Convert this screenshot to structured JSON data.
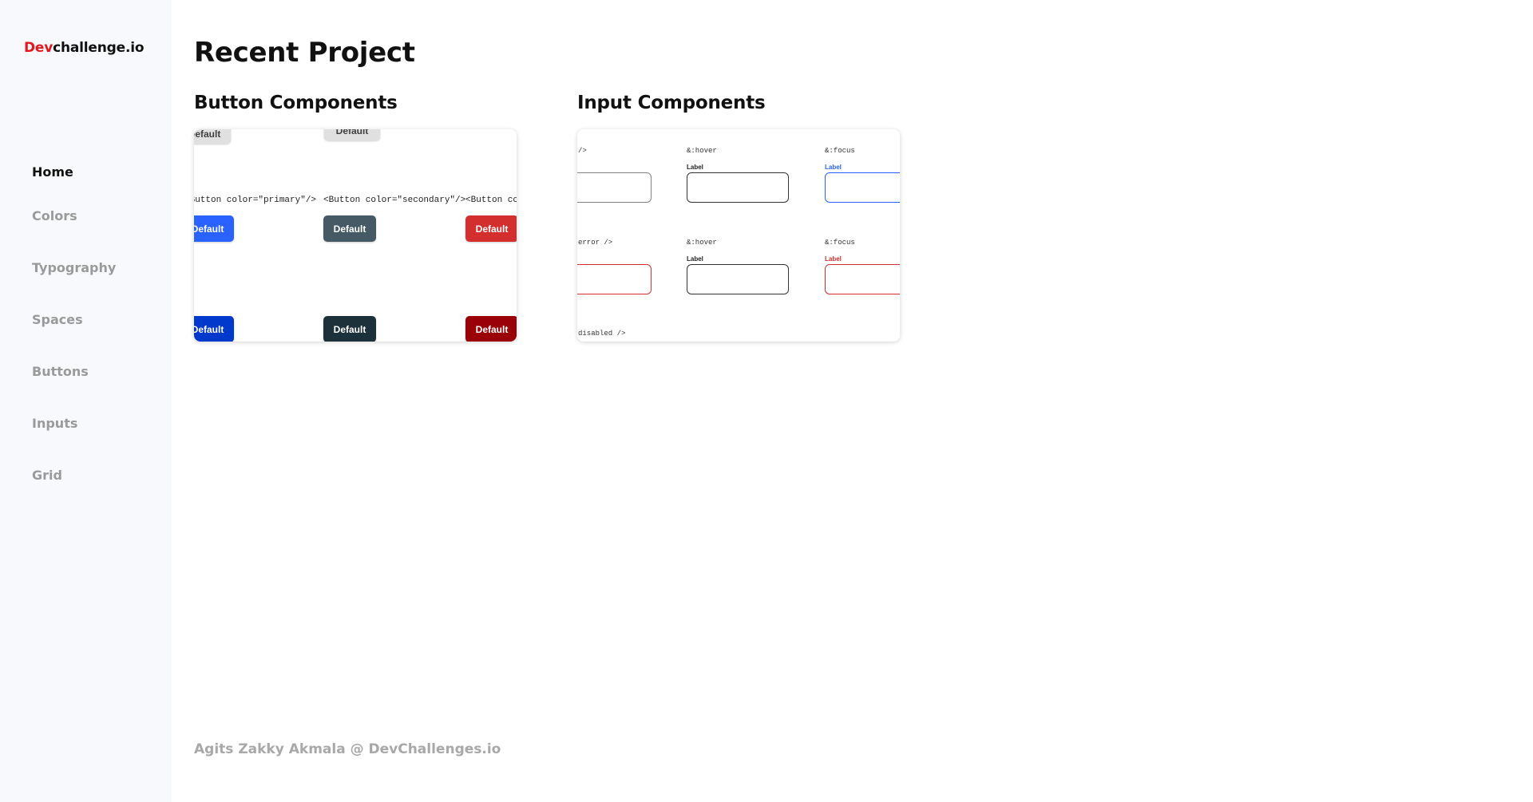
{
  "sidebar": {
    "logo_accent": "Dev",
    "logo_rest": "challenge.io",
    "items": [
      {
        "label": "Home"
      },
      {
        "label": "Colors"
      },
      {
        "label": "Typography"
      },
      {
        "label": "Spaces"
      },
      {
        "label": "Buttons"
      },
      {
        "label": "Inputs"
      },
      {
        "label": "Grid"
      }
    ]
  },
  "main": {
    "title": "Recent Project",
    "cards": [
      {
        "title": "Button Components",
        "preview": {
          "ghost_labels": [
            "Default",
            "Default"
          ],
          "code_labels": [
            "<Button color=\"primary\"/>",
            "<Button color=\"secondary\"/>",
            "<Button colo"
          ],
          "buttons": [
            {
              "label": "Default",
              "color": "#2962ff"
            },
            {
              "label": "Default",
              "color": "#455a64"
            },
            {
              "label": "Default",
              "color": "#d32f2f"
            },
            {
              "label": "Default",
              "color": "#0039cb"
            },
            {
              "label": "Default",
              "color": "#1c313a"
            },
            {
              "label": "Default",
              "color": "#9a0007"
            }
          ]
        }
      },
      {
        "title": "Input Components",
        "preview": {
          "codes": [
            "/>",
            "&:hover",
            "&:focus",
            "error />",
            "&:hover",
            "&:focus",
            "disabled />"
          ],
          "labels": [
            "Label",
            "Label",
            "Label",
            "Label"
          ],
          "focus_color": "#2962ff",
          "error_color": "#d32f2f"
        }
      }
    ]
  },
  "footer": {
    "text": "Agits Zakky Akmala @ DevChallenges.io"
  }
}
